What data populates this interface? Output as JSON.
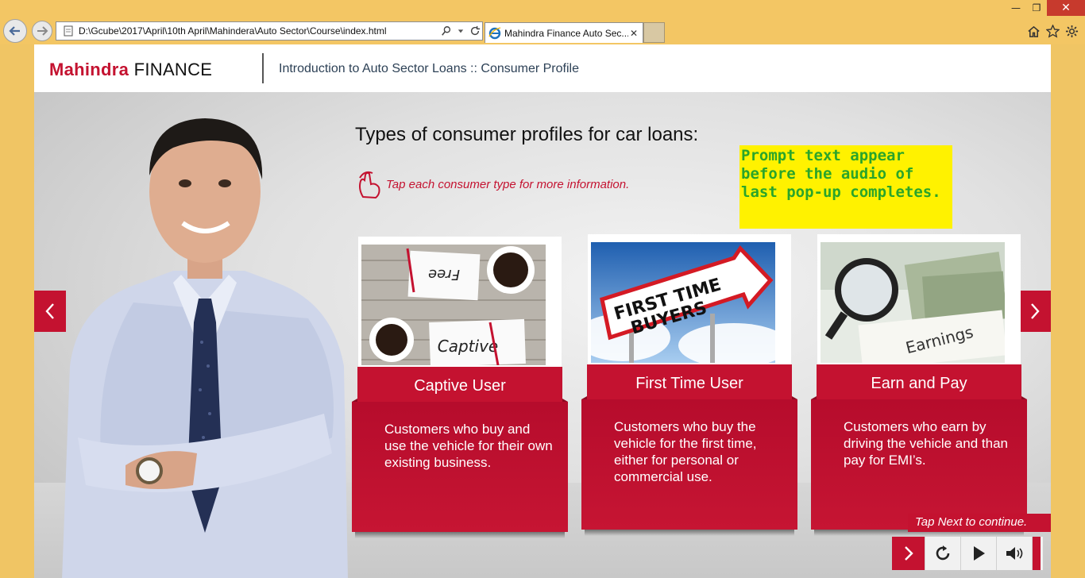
{
  "browser": {
    "url": "D:\\Gcube\\2017\\April\\10th April\\Mahindera\\Auto Sector\\Course\\index.html",
    "tab_title": "Mahindra Finance Auto Sec...",
    "window_buttons": {
      "minimize": "—",
      "restore": "❐",
      "close": "✕"
    }
  },
  "header": {
    "logo_brand": "Mahindra",
    "logo_word": "FINANCE",
    "course_title": "Introduction to Auto Sector Loans :: Consumer Profile"
  },
  "content": {
    "heading": "Types of consumer profiles for car loans:",
    "instruction": "Tap each consumer type for more information.",
    "note": "Prompt text appear before the audio of last pop-up completes.",
    "cards": [
      {
        "label": "Captive User",
        "description": "Customers who buy and use the vehicle for their own existing business.",
        "image_words": [
          "Free",
          "Captive"
        ]
      },
      {
        "label": "First Time User",
        "description": "Customers who buy the vehicle for the first time, either for personal or commercial use.",
        "image_words": [
          "FIRST TIME",
          "BUYERS"
        ]
      },
      {
        "label": "Earn and Pay",
        "description": "Customers who earn by driving the vehicle and than pay for EMI’s.",
        "image_words": [
          "Earnings"
        ]
      }
    ]
  },
  "footer": {
    "tap_next": "Tap Next to continue."
  },
  "colors": {
    "brand_red": "#c41230",
    "note_yellow": "#fff200",
    "note_text": "#2aa52a",
    "browser_frame": "#f3c664"
  },
  "icons": [
    "back-arrow-icon",
    "forward-arrow-icon",
    "search-icon",
    "refresh-icon",
    "ie-icon",
    "home-icon",
    "star-icon",
    "gear-icon",
    "tap-hand-icon",
    "chevron-left-icon",
    "chevron-right-icon",
    "replay-icon",
    "play-icon",
    "volume-icon"
  ]
}
